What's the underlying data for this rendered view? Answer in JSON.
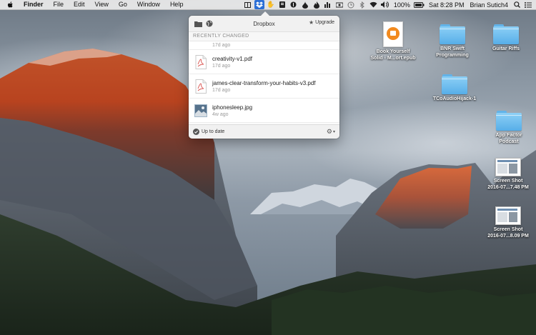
{
  "menubar": {
    "app_name": "Finder",
    "menus": [
      "File",
      "Edit",
      "View",
      "Go",
      "Window",
      "Help"
    ],
    "status_icons": [
      "window-icon",
      "dropbox-icon",
      "hand-icon",
      "evernote-icon",
      "info-icon",
      "drop-icon",
      "flame-icon",
      "equalizer-icon",
      "sound-icon",
      "clock-icon",
      "bluetooth-icon",
      "wifi-icon",
      "volume-icon"
    ],
    "battery": "100%",
    "datetime": "Sat 8:28 PM",
    "user": "Brian Sutich4"
  },
  "dropbox": {
    "title": "Dropbox",
    "upgrade_label": "Upgrade",
    "section_label": "RECENTLY CHANGED",
    "partial_item_time": "17d ago",
    "files": [
      {
        "name": "creativity-v1.pdf",
        "time": "17d ago",
        "icon": "pdf-icon"
      },
      {
        "name": "james-clear-transform-your-habits-v3.pdf",
        "time": "17d ago",
        "icon": "pdf-icon"
      },
      {
        "name": "iphonesleep.jpg",
        "time": "4w ago",
        "icon": "image-thumbnail"
      }
    ],
    "status": "Up to date",
    "accent_color": "#2b6fd6"
  },
  "desktop": {
    "items": [
      {
        "label_lines": [
          "Book Yourself",
          "Solid - M...ort.epub"
        ],
        "kind": "epub"
      },
      {
        "label_lines": [
          "BNR Swift",
          "Programming"
        ],
        "kind": "folder"
      },
      {
        "label_lines": [
          "Guitar Riffs"
        ],
        "kind": "folder"
      },
      {
        "label_lines": [
          "TCoAudioHijack-1"
        ],
        "kind": "folder"
      },
      {
        "label_lines": [
          "App Factor",
          "Podcast"
        ],
        "kind": "folder"
      },
      {
        "label_lines": [
          "Screen Shot",
          "2016-07...7.48 PM"
        ],
        "kind": "screenshot"
      },
      {
        "label_lines": [
          "Screen Shot",
          "2016-07...8.09 PM"
        ],
        "kind": "screenshot"
      }
    ]
  }
}
